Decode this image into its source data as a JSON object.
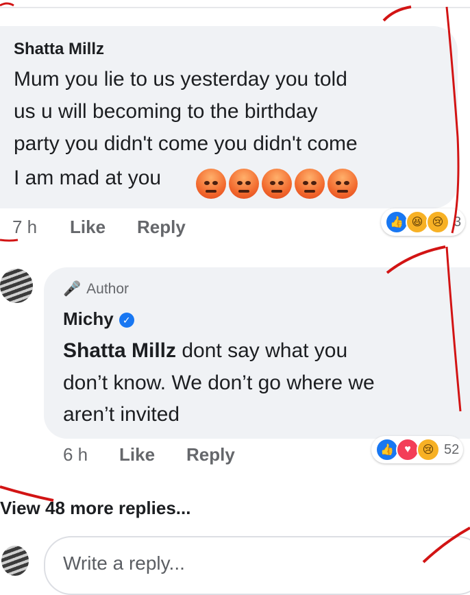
{
  "comment1": {
    "author": "Shatta Millz",
    "lines": [
      "Mum you lie to us yesterday you told",
      "us u will becoming to the birthday",
      "party you didn't come you didn't come",
      "I am mad at you"
    ],
    "emoji": [
      "angry-face",
      "angry-face",
      "angry-face",
      "angry-face",
      "angry-face"
    ],
    "time": "7 h",
    "like_label": "Like",
    "reply_label": "Reply",
    "reactions": [
      "like",
      "haha",
      "sad"
    ],
    "reaction_count": "3"
  },
  "reply1": {
    "badge": "Author",
    "author": "Michy",
    "mention": "Shatta Millz",
    "line1_rest": " dont say what you",
    "line2": "don’t know. We don’t go where we",
    "line3": "aren’t invited",
    "time": "6 h",
    "like_label": "Like",
    "reply_label": "Reply",
    "reactions": [
      "like",
      "love",
      "sad"
    ],
    "reaction_count": "52"
  },
  "view_more": "View 48 more replies...",
  "reply_box": {
    "placeholder": "Write a reply..."
  },
  "colors": {
    "bubble": "#f0f2f5",
    "meta": "#65676b",
    "accent": "#1877f2",
    "annotation": "#d21414"
  }
}
